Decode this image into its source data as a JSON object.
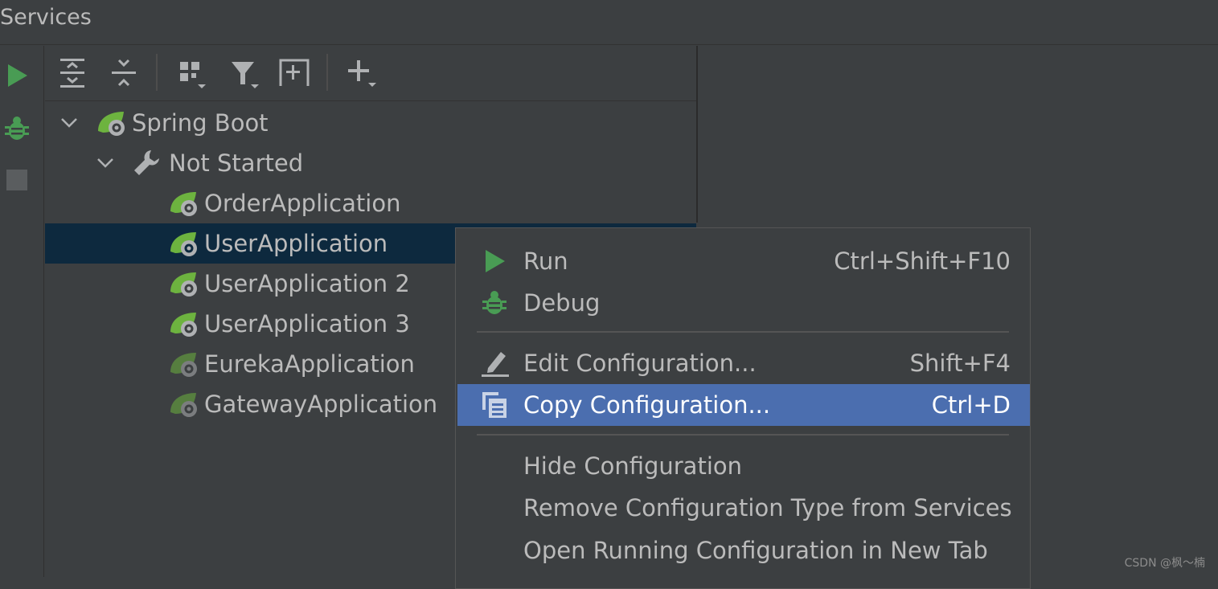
{
  "window": {
    "title": "Services"
  },
  "toolbar": {
    "icons": [
      "expand-all-icon",
      "collapse-all-icon",
      "group-by-icon",
      "filter-icon",
      "new-service-icon",
      "add-icon"
    ]
  },
  "side_actions": [
    "run-icon",
    "debug-icon",
    "stop-icon"
  ],
  "tree": {
    "root": {
      "label": "Spring Boot",
      "expanded": true
    },
    "group": {
      "label": "Not Started",
      "expanded": true
    },
    "items": [
      {
        "label": "OrderApplication",
        "selected": false,
        "enabled": true
      },
      {
        "label": "UserApplication",
        "selected": true,
        "enabled": true
      },
      {
        "label": "UserApplication 2",
        "selected": false,
        "enabled": true
      },
      {
        "label": "UserApplication 3",
        "selected": false,
        "enabled": true
      },
      {
        "label": "EurekaApplication",
        "selected": false,
        "enabled": false
      },
      {
        "label": "GatewayApplication",
        "selected": false,
        "enabled": false
      }
    ]
  },
  "context_menu": {
    "items": [
      {
        "label": "Run",
        "shortcut": "Ctrl+Shift+F10",
        "icon": "run-icon"
      },
      {
        "label": "Debug",
        "shortcut": "",
        "icon": "debug-icon"
      },
      {
        "label": "Edit Configuration...",
        "shortcut": "Shift+F4",
        "icon": "edit-icon"
      },
      {
        "label": "Copy Configuration...",
        "shortcut": "Ctrl+D",
        "icon": "copy-icon",
        "highlighted": true
      },
      {
        "label": "Hide Configuration",
        "shortcut": ""
      },
      {
        "label": "Remove Configuration Type from Services",
        "shortcut": ""
      },
      {
        "label": "Open Running Configuration in New Tab",
        "shortcut": ""
      }
    ]
  },
  "watermark": "CSDN @枫～楠",
  "colors": {
    "background": "#3c3f41",
    "selection": "#0d293e",
    "menu_highlight": "#4b6eaf",
    "run_green": "#499c54",
    "spring_green": "#6db33f"
  }
}
